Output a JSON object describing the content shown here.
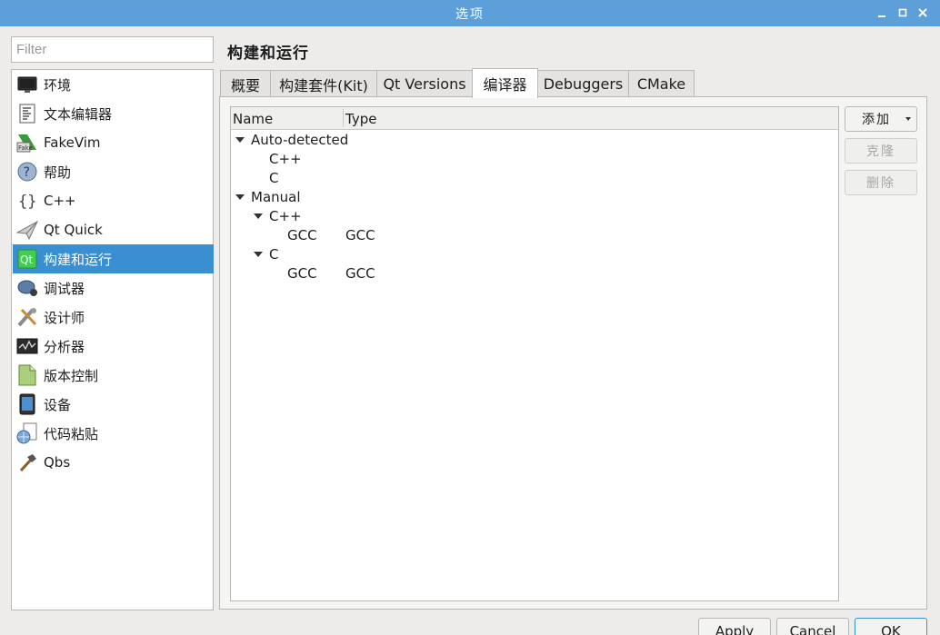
{
  "window": {
    "title": "选项",
    "minimize_glyph": "▁",
    "maximize_glyph": "□",
    "close_glyph": "✕"
  },
  "filter": {
    "placeholder": "Filter",
    "value": ""
  },
  "sidebar": {
    "items": [
      {
        "label": "环境",
        "icon": "monitor-icon"
      },
      {
        "label": "文本编辑器",
        "icon": "text-editor-icon"
      },
      {
        "label": "FakeVim",
        "icon": "fakevim-icon"
      },
      {
        "label": "帮助",
        "icon": "help-icon"
      },
      {
        "label": "C++",
        "icon": "braces-icon"
      },
      {
        "label": "Qt Quick",
        "icon": "paper-plane-icon"
      },
      {
        "label": "构建和运行",
        "icon": "qt-build-icon",
        "selected": true
      },
      {
        "label": "调试器",
        "icon": "debugger-bug-icon"
      },
      {
        "label": "设计师",
        "icon": "designer-tools-icon"
      },
      {
        "label": "分析器",
        "icon": "analyzer-icon"
      },
      {
        "label": "版本控制",
        "icon": "version-control-icon"
      },
      {
        "label": "设备",
        "icon": "device-icon"
      },
      {
        "label": "代码粘贴",
        "icon": "code-paste-icon"
      },
      {
        "label": "Qbs",
        "icon": "hammer-icon"
      }
    ]
  },
  "page": {
    "title": "构建和运行"
  },
  "tabs": [
    {
      "label": "概要"
    },
    {
      "label": "构建套件(Kit)"
    },
    {
      "label": "Qt Versions"
    },
    {
      "label": "编译器",
      "active": true
    },
    {
      "label": "Debuggers"
    },
    {
      "label": "CMake"
    }
  ],
  "tree": {
    "columns": {
      "name": "Name",
      "type": "Type"
    },
    "rows": [
      {
        "name": "Auto-detected",
        "type": "",
        "expanded": true
      },
      {
        "name": "C++",
        "type": ""
      },
      {
        "name": "C",
        "type": ""
      },
      {
        "name": "Manual",
        "type": "",
        "expanded": true
      },
      {
        "name": "C++",
        "type": "",
        "expanded": true
      },
      {
        "name": "GCC",
        "type": "GCC"
      },
      {
        "name": "C",
        "type": "",
        "expanded": true
      },
      {
        "name": "GCC",
        "type": "GCC"
      }
    ]
  },
  "buttons": {
    "add": "添加",
    "clone": "克隆",
    "remove": "删除"
  },
  "dialog_buttons": {
    "apply": "Apply",
    "cancel": "Cancel",
    "ok": "OK"
  },
  "colors": {
    "titlebar": "#5d9fd8",
    "selection": "#3a8fd1"
  }
}
